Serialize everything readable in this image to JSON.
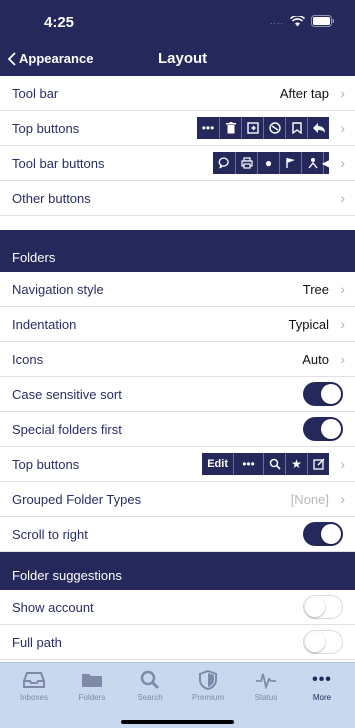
{
  "status": {
    "time": "4:25",
    "signal": "...."
  },
  "nav": {
    "back_label": "Appearance",
    "title": "Layout"
  },
  "rows": {
    "tool_bar": {
      "label": "Tool bar",
      "value": "After tap"
    },
    "top_buttons": {
      "label": "Top buttons"
    },
    "tool_bar_buttons": {
      "label": "Tool bar buttons"
    },
    "other_buttons": {
      "label": "Other buttons"
    }
  },
  "folders": {
    "header": "Folders",
    "navigation_style": {
      "label": "Navigation style",
      "value": "Tree"
    },
    "indentation": {
      "label": "Indentation",
      "value": "Typical"
    },
    "icons": {
      "label": "Icons",
      "value": "Auto"
    },
    "case_sensitive_sort": {
      "label": "Case sensitive sort",
      "on": true
    },
    "special_folders_first": {
      "label": "Special folders first",
      "on": true
    },
    "top_buttons": {
      "label": "Top buttons",
      "edit_label": "Edit"
    },
    "grouped_folder_types": {
      "label": "Grouped Folder Types",
      "value": "[None]"
    },
    "scroll_to_right": {
      "label": "Scroll to right",
      "on": true
    }
  },
  "suggestions": {
    "header": "Folder suggestions",
    "show_account": {
      "label": "Show account",
      "on": false
    },
    "full_path": {
      "label": "Full path",
      "on": false
    }
  },
  "tabs": [
    {
      "label": "Inboxes",
      "icon": "inbox-icon"
    },
    {
      "label": "Folders",
      "icon": "folder-icon"
    },
    {
      "label": "Search",
      "icon": "search-icon"
    },
    {
      "label": "Premium",
      "icon": "shield-icon"
    },
    {
      "label": "Status",
      "icon": "pulse-icon"
    },
    {
      "label": "More",
      "icon": "more-icon"
    }
  ],
  "colors": {
    "navy": "#24285a",
    "tab_bar": "#c8d8ee",
    "label": "#2a2d66"
  }
}
